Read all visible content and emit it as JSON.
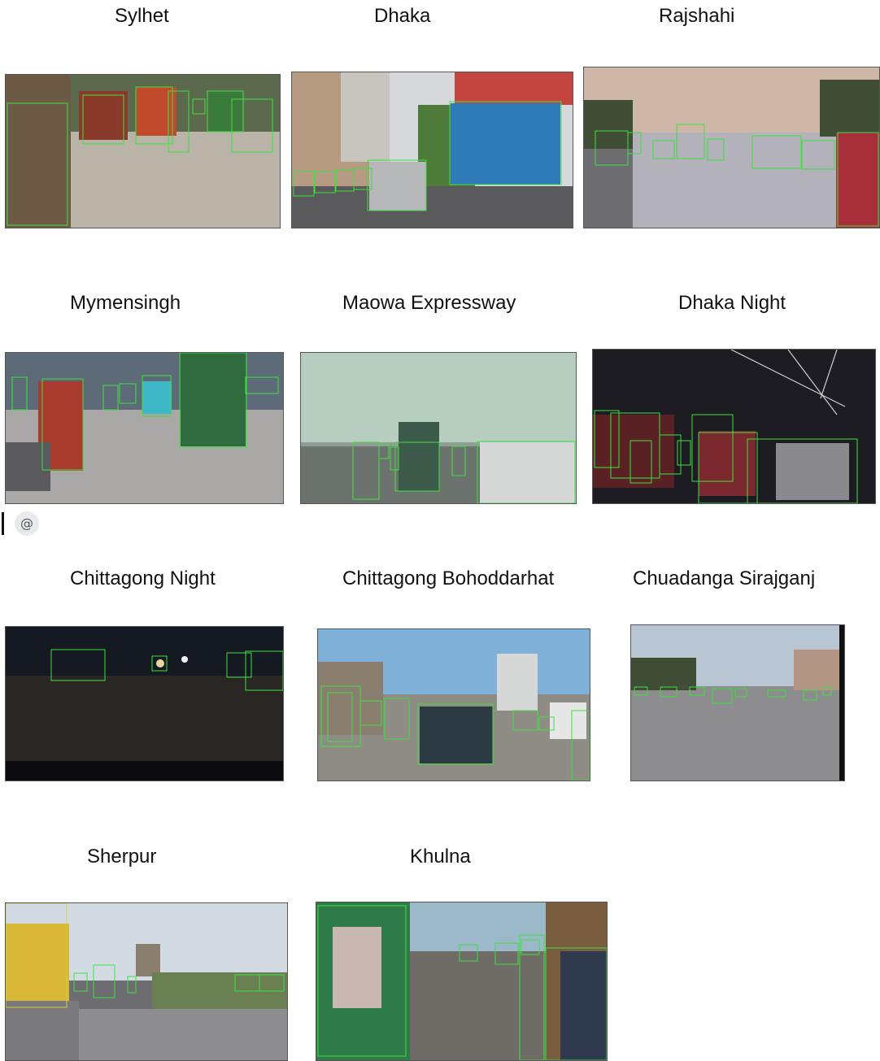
{
  "panels": [
    {
      "caption": "Sylhet",
      "scene": "daytime street with rickshaws"
    },
    {
      "caption": "Dhaka",
      "scene": "city street with bus and car"
    },
    {
      "caption": "Rajshahi",
      "scene": "highway at dusk"
    },
    {
      "caption": "Mymensingh",
      "scene": "market street with cargo vehicle"
    },
    {
      "caption": "Maowa Expressway",
      "scene": "hazy expressway"
    },
    {
      "caption": "Dhaka Night",
      "scene": "night traffic"
    },
    {
      "caption": "Chittagong Night",
      "scene": "dark road at night"
    },
    {
      "caption": "Chittagong Bohoddarhat",
      "scene": "street with car and truck"
    },
    {
      "caption": "Chuadanga Sirajganj",
      "scene": "empty road at dusk"
    },
    {
      "caption": "Sherpur",
      "scene": "rural road with truck and motorbike"
    },
    {
      "caption": "Khulna",
      "scene": "view from auto-rickshaw"
    }
  ],
  "mention_badge": {
    "symbol": "@"
  },
  "colors": {
    "bbox": "#3fe03f"
  }
}
